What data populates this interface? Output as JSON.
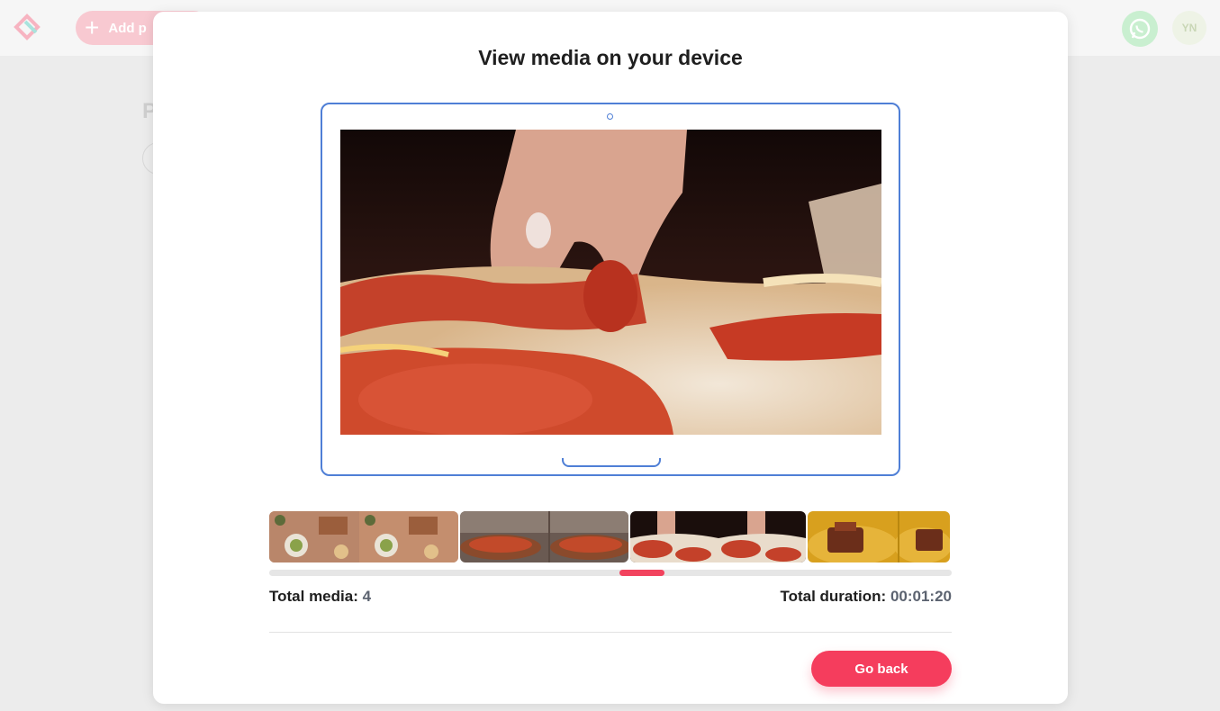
{
  "background": {
    "add_button_label": "Add p",
    "page_heading": "P",
    "avatar_initials": "YN"
  },
  "modal": {
    "title": "View media on your device",
    "stats": {
      "total_media_label": "Total media:",
      "total_media_value": "4",
      "total_duration_label": "Total duration:",
      "total_duration_value": "00:01:20"
    },
    "go_back_label": "Go back"
  },
  "colors": {
    "accent": "#f53d5d",
    "device_outline": "#4f7fd6",
    "whatsapp": "#25d366"
  },
  "icons": [
    "logo-icon",
    "plus-icon",
    "whatsapp-icon"
  ],
  "media": [
    {
      "name": "charcuterie-board"
    },
    {
      "name": "pizza-board"
    },
    {
      "name": "pizza-slice-closeup"
    },
    {
      "name": "cake-and-pasta"
    }
  ],
  "scroll_position_fraction": 0.55
}
